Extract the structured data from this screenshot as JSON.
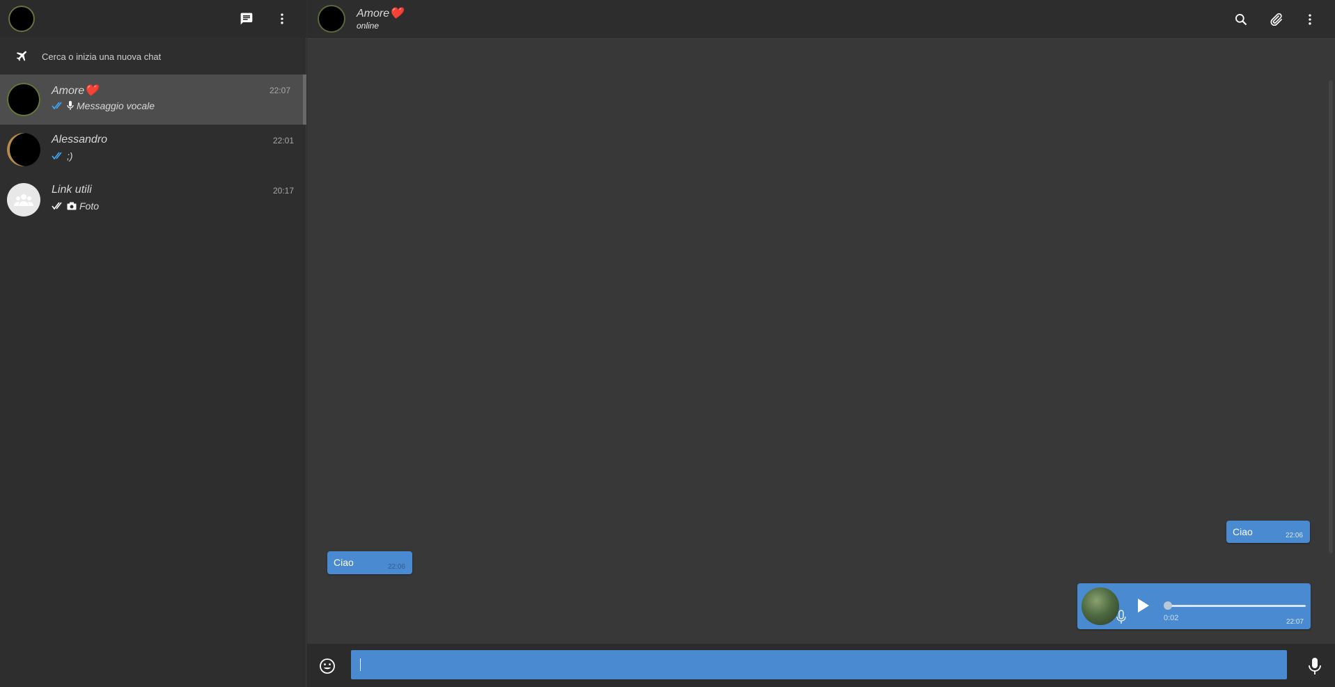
{
  "sidebar": {
    "search_placeholder": "Cerca o inizia una nuova chat",
    "chats": [
      {
        "name": "Amore❤️",
        "time": "22:07",
        "preview": "Messaggio vocale",
        "preview_icon": "mic-icon",
        "status_icon": "double-check-read-icon",
        "active": true
      },
      {
        "name": "Alessandro",
        "time": "22:01",
        "preview": ";)",
        "status_icon": "double-check-read-icon",
        "active": false
      },
      {
        "name": "Link utili",
        "time": "20:17",
        "preview": "Foto",
        "preview_icon": "camera-icon",
        "status_icon": "double-check-icon",
        "active": false
      }
    ]
  },
  "chat": {
    "name": "Amore❤️",
    "status": "online",
    "messages": [
      {
        "direction": "out",
        "text": "Ciao",
        "time": "22:06"
      },
      {
        "direction": "in",
        "text": "Ciao",
        "time": "22:06"
      },
      {
        "direction": "out",
        "type": "voice",
        "duration": "0:02",
        "time": "22:07",
        "progress": 0
      }
    ]
  },
  "colors": {
    "accent": "#4a8ad0",
    "read_check": "#3fa9f5",
    "background": "#383838",
    "sidebar": "#2e2e2e"
  }
}
